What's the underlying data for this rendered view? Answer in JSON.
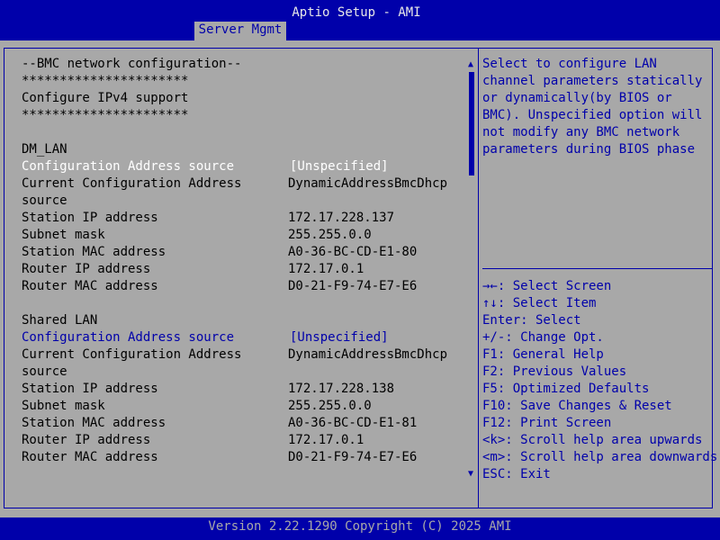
{
  "header": {
    "title": "Aptio Setup - AMI",
    "tab": "Server Mgmt"
  },
  "rows": [
    {
      "label": "--BMC network configuration--",
      "value": ""
    },
    {
      "label": "**********************",
      "value": ""
    },
    {
      "label": "Configure IPv4 support",
      "value": ""
    },
    {
      "label": "**********************",
      "value": ""
    },
    {
      "label": "",
      "value": ""
    },
    {
      "label": "DM_LAN",
      "value": ""
    },
    {
      "label": "Configuration Address source",
      "value": "[Unspecified]"
    },
    {
      "label": "Current Configuration Address",
      "value": "DynamicAddressBmcDhcp"
    },
    {
      "label": "source",
      "value": ""
    },
    {
      "label": "Station IP address",
      "value": "172.17.228.137"
    },
    {
      "label": "Subnet mask",
      "value": "255.255.0.0"
    },
    {
      "label": "Station MAC address",
      "value": "A0-36-BC-CD-E1-80"
    },
    {
      "label": "Router IP address",
      "value": "172.17.0.1"
    },
    {
      "label": "Router MAC address",
      "value": "D0-21-F9-74-E7-E6"
    },
    {
      "label": "",
      "value": ""
    },
    {
      "label": "Shared LAN",
      "value": ""
    },
    {
      "label": "Configuration Address source",
      "value": "[Unspecified]"
    },
    {
      "label": "Current Configuration Address",
      "value": "DynamicAddressBmcDhcp"
    },
    {
      "label": "source",
      "value": ""
    },
    {
      "label": "Station IP address",
      "value": "172.17.228.138"
    },
    {
      "label": "Subnet mask",
      "value": "255.255.0.0"
    },
    {
      "label": "Station MAC address",
      "value": "A0-36-BC-CD-E1-81"
    },
    {
      "label": "Router IP address",
      "value": "172.17.0.1"
    },
    {
      "label": "Router MAC address",
      "value": "D0-21-F9-74-E7-E6"
    }
  ],
  "help": [
    "Select to configure LAN",
    "channel parameters statically",
    "or dynamically(by BIOS or",
    "BMC). Unspecified option will",
    "not modify any BMC network",
    "parameters during BIOS phase"
  ],
  "keys": [
    "→←: Select Screen",
    "↑↓: Select Item",
    "Enter: Select",
    "+/-: Change Opt.",
    "F1: General Help",
    "F2: Previous Values",
    "F5: Optimized Defaults",
    "F10: Save Changes & Reset",
    "F12: Print Screen",
    "<k>: Scroll help area upwards",
    "<m>: Scroll help area downwards",
    "ESC: Exit"
  ],
  "scroll": {
    "up": "▲",
    "down": "▼"
  },
  "footer": "Version 2.22.1290 Copyright (C) 2025 AMI",
  "colors": {
    "blue": "#0000aa",
    "gray": "#a8a8a8",
    "white": "#ffffff"
  }
}
